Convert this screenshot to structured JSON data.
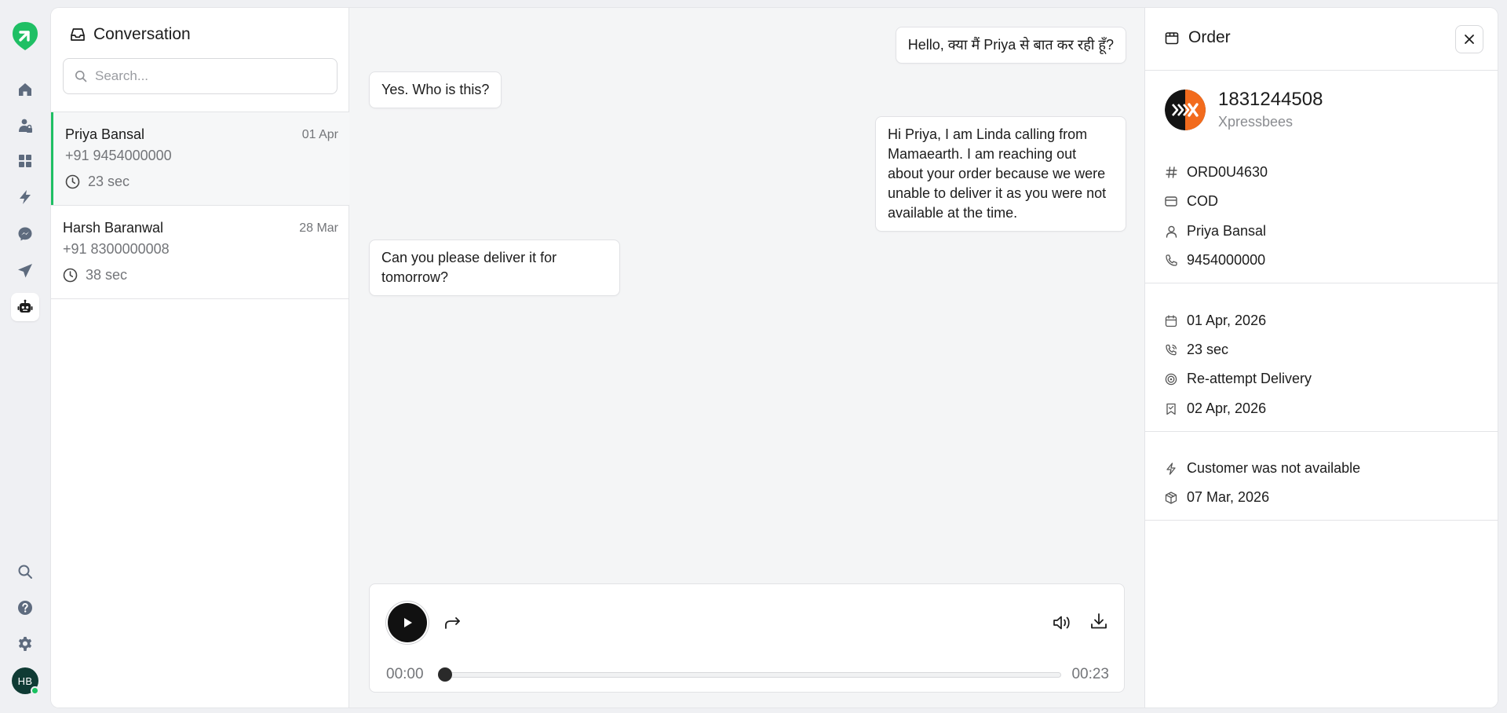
{
  "nav": {
    "items": [
      "home-icon",
      "lock-person-icon",
      "dashboard-icon",
      "bolt-icon",
      "messenger-icon",
      "send-icon",
      "bot-icon"
    ],
    "active": "bot-icon",
    "bottom": [
      "search-icon",
      "help-icon",
      "settings-icon"
    ],
    "user_initials": "HB"
  },
  "conversations": {
    "title": "Conversation",
    "search_placeholder": "Search...",
    "items": [
      {
        "name": "Priya Bansal",
        "date": "01 Apr",
        "phone": "+91 9454000000",
        "duration": "23 sec",
        "active": true
      },
      {
        "name": "Harsh Baranwal",
        "date": "28 Mar",
        "phone": "+91 8300000008",
        "duration": "38 sec",
        "active": false
      }
    ]
  },
  "chat": {
    "messages": [
      {
        "side": "right",
        "text": "Hello, क्या मैं Priya से बात कर रही हूँ?"
      },
      {
        "side": "left",
        "text": "Yes. Who is this?"
      },
      {
        "side": "right",
        "text": "Hi Priya, I am Linda calling from Mamaearth. I am reaching out about your order because we were unable to deliver it as you were not available at the time."
      },
      {
        "side": "left",
        "text": "Can you please deliver it for tomorrow?"
      }
    ],
    "player": {
      "current_time": "00:00",
      "total_time": "00:23",
      "progress": 0
    }
  },
  "order": {
    "title": "Order",
    "awb": "1831244508",
    "carrier": "Xpressbees",
    "order_id": "ORD0U4630",
    "payment": "COD",
    "customer": "Priya Bansal",
    "phone": "9454000000",
    "call_date": "01 Apr, 2026",
    "call_duration": "23 sec",
    "disposition": "Re-attempt Delivery",
    "reattempt_date": "02 Apr, 2026",
    "ndr_reason": "Customer was not available",
    "order_date": "07 Mar, 2026"
  },
  "colors": {
    "brand_green": "#1fbf64",
    "xpressbees_orange": "#f26b1d"
  }
}
